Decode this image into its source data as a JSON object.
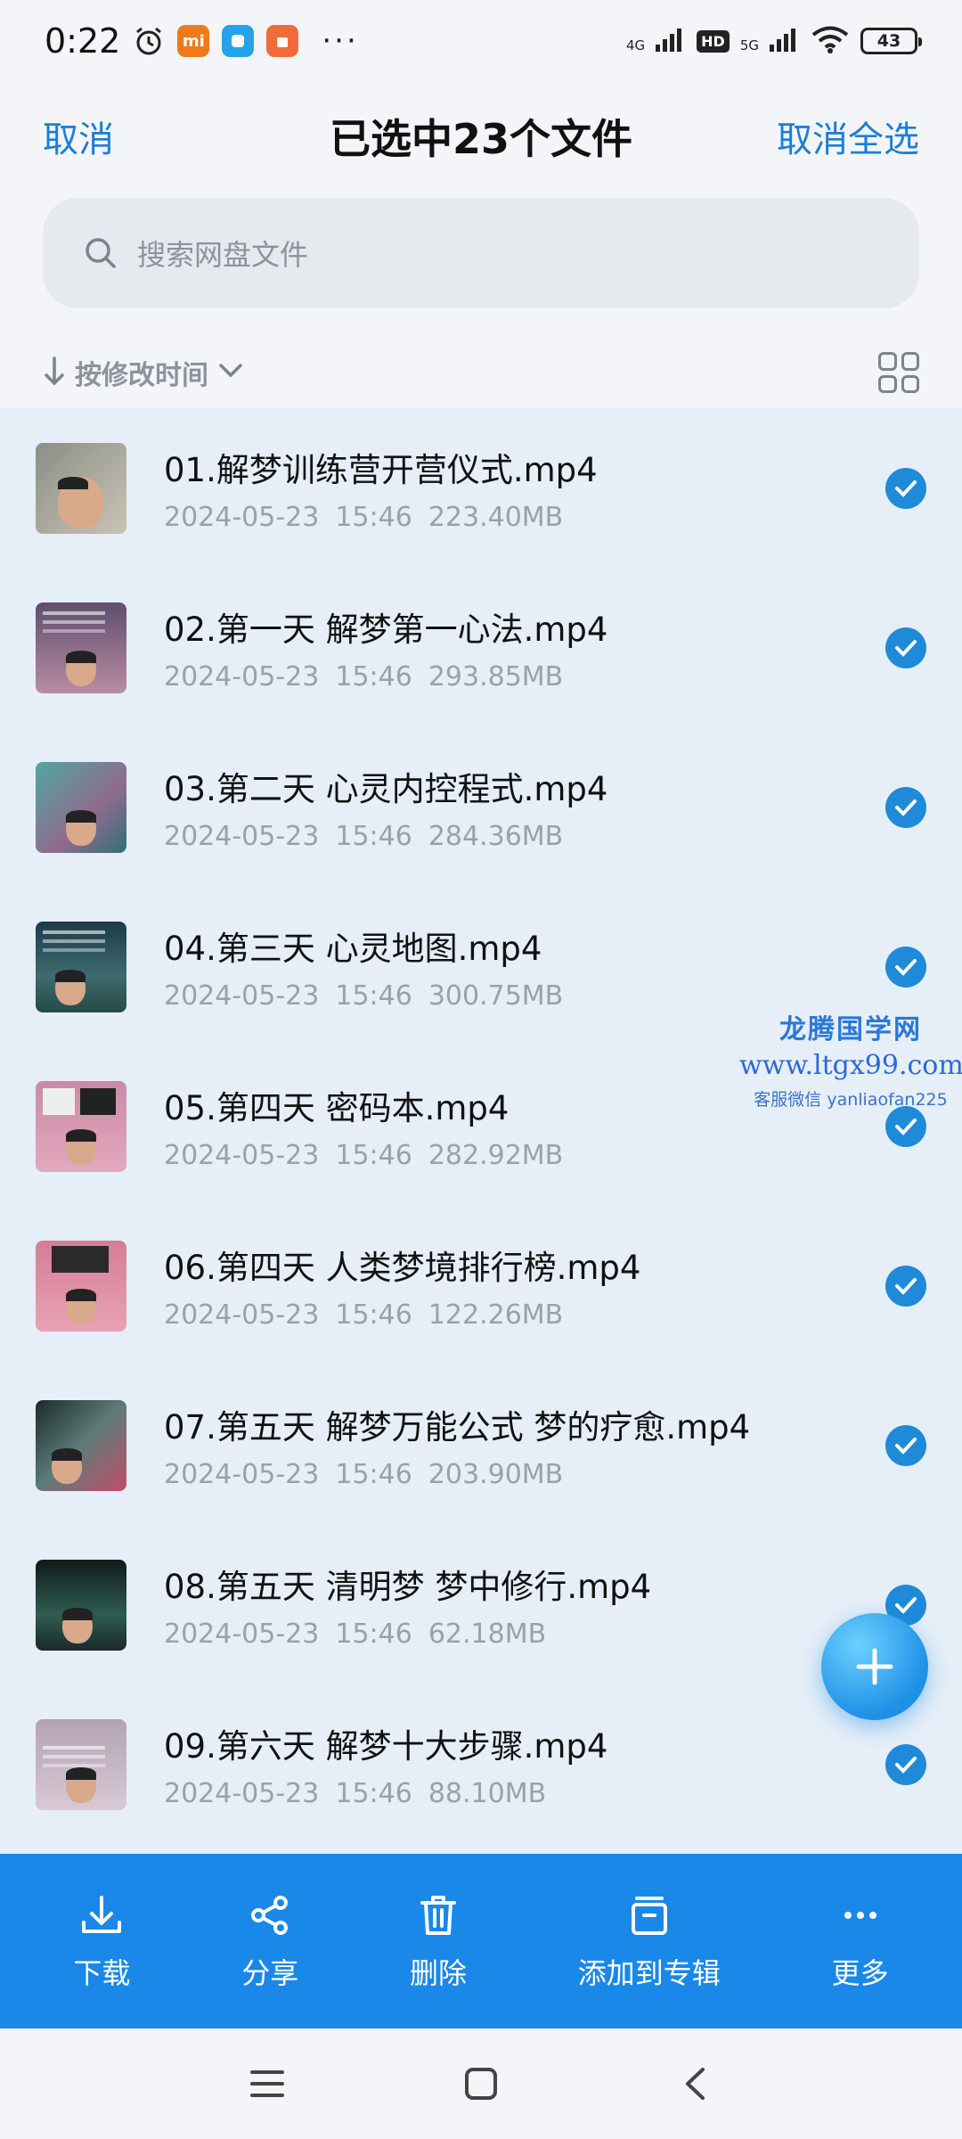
{
  "status_bar": {
    "time": "0:22",
    "signal1_label": "4G",
    "hd_label": "HD",
    "signal2_label": "5G",
    "battery": "43",
    "more": "···"
  },
  "header": {
    "cancel": "取消",
    "title": "已选中23个文件",
    "cancel_all": "取消全选"
  },
  "search": {
    "placeholder": "搜索网盘文件"
  },
  "sort": {
    "label": "按修改时间"
  },
  "files": [
    {
      "name": "01.解梦训练营开营仪式.mp4",
      "date": "2024-05-23",
      "time": "15:46",
      "size": "223.40MB"
    },
    {
      "name": "02.第一天 解梦第一心法.mp4",
      "date": "2024-05-23",
      "time": "15:46",
      "size": "293.85MB"
    },
    {
      "name": "03.第二天 心灵内控程式.mp4",
      "date": "2024-05-23",
      "time": "15:46",
      "size": "284.36MB"
    },
    {
      "name": "04.第三天 心灵地图.mp4",
      "date": "2024-05-23",
      "time": "15:46",
      "size": "300.75MB"
    },
    {
      "name": "05.第四天 密码本.mp4",
      "date": "2024-05-23",
      "time": "15:46",
      "size": "282.92MB"
    },
    {
      "name": "06.第四天 人类梦境排行榜.mp4",
      "date": "2024-05-23",
      "time": "15:46",
      "size": "122.26MB"
    },
    {
      "name": "07.第五天 解梦万能公式 梦的疗愈.mp4",
      "date": "2024-05-23",
      "time": "15:46",
      "size": "203.90MB"
    },
    {
      "name": "08.第五天 清明梦 梦中修行.mp4",
      "date": "2024-05-23",
      "time": "15:46",
      "size": "62.18MB"
    },
    {
      "name": "09.第六天 解梦十大步骤.mp4",
      "date": "2024-05-23",
      "time": "15:46",
      "size": "88.10MB"
    }
  ],
  "watermark": {
    "line1": "龙腾国学网",
    "line2": "www.ltgx99.com",
    "line3": "客服微信 yanliaofan225"
  },
  "actions": {
    "download": "下载",
    "share": "分享",
    "delete": "删除",
    "add_to_album": "添加到专辑",
    "more": "更多"
  },
  "colors": {
    "accent": "#1c7fd6",
    "action_bar": "#1988e8",
    "check": "#1e8ad8",
    "list_bg": "#e6eef8"
  }
}
